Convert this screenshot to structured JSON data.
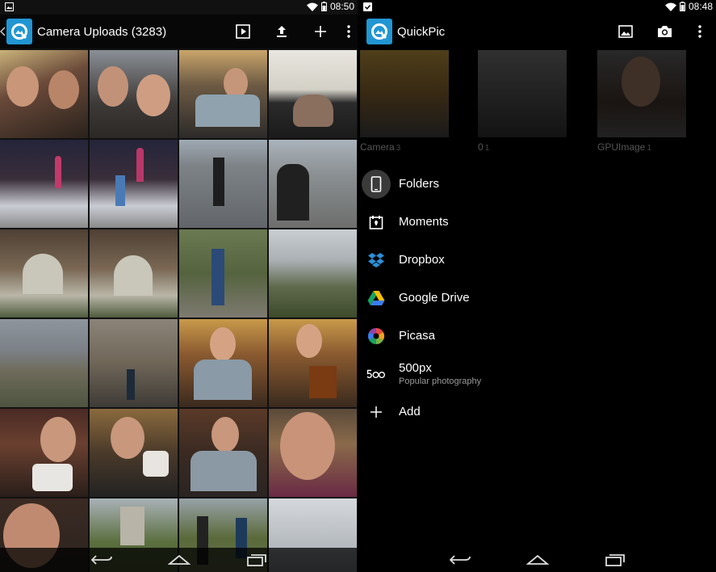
{
  "left_screen": {
    "status_time": "08:50",
    "title": "Camera Uploads (3283)",
    "actions": [
      "slideshow-icon",
      "upload-icon",
      "add-icon",
      "overflow-menu-icon"
    ]
  },
  "right_screen": {
    "status_time": "08:48",
    "title": "QuickPic",
    "actions": [
      "gallery-icon",
      "camera-icon",
      "overflow-menu-icon"
    ],
    "albums": [
      {
        "name": "Camera",
        "count": "3"
      },
      {
        "name": "0",
        "count": "1"
      },
      {
        "name": "GPUImage",
        "count": "1"
      }
    ],
    "menu": [
      {
        "label": "Folders",
        "sub": "",
        "icon": "phone-icon",
        "active": true
      },
      {
        "label": "Moments",
        "sub": "",
        "icon": "calendar-icon",
        "active": false
      },
      {
        "label": "Dropbox",
        "sub": "",
        "icon": "dropbox-icon",
        "active": false
      },
      {
        "label": "Google Drive",
        "sub": "",
        "icon": "google-drive-icon",
        "active": false
      },
      {
        "label": "Picasa",
        "sub": "",
        "icon": "picasa-icon",
        "active": false
      },
      {
        "label": "500px",
        "sub": "Popular photography",
        "icon": "500px-icon",
        "active": false
      },
      {
        "label": "Add",
        "sub": "",
        "icon": "plus-icon",
        "active": false
      }
    ]
  },
  "colors": {
    "accent": "#2196d3",
    "background": "#000000",
    "text": "#ffffff",
    "secondary_text": "#9a9a9a",
    "active_highlight": "#3a3a3a"
  }
}
